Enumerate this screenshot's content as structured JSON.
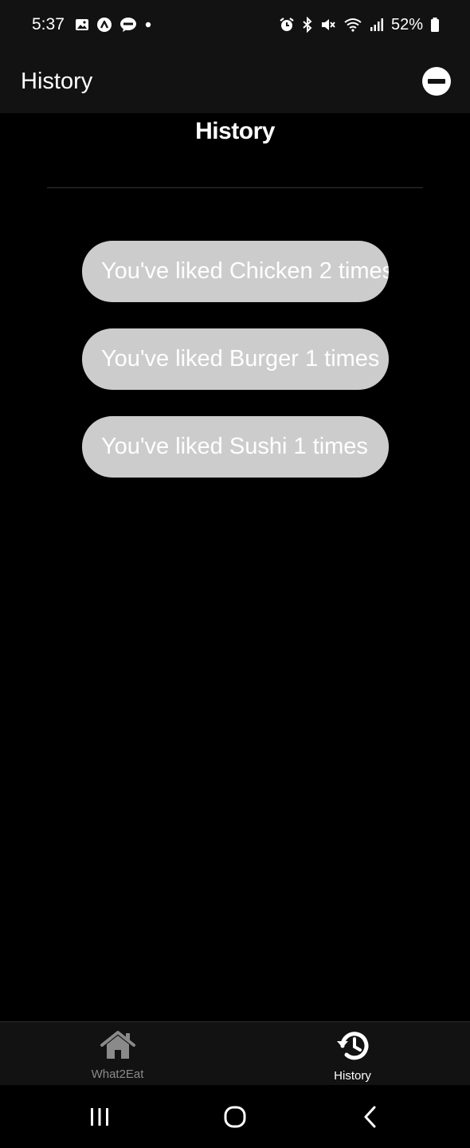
{
  "status_bar": {
    "time": "5:37",
    "battery": "52%",
    "left_icons": [
      "gallery-icon",
      "app-notification-icon",
      "talk-chat-icon",
      "dot-icon"
    ],
    "right_icons": [
      "alarm-icon",
      "bluetooth-icon",
      "mute-icon",
      "wifi-icon",
      "signal-icon",
      "battery-icon"
    ]
  },
  "app_bar": {
    "title": "History",
    "action_icon": "minus-circle-icon"
  },
  "page": {
    "heading": "History",
    "items": [
      {
        "label": "You've liked Chicken 2 times"
      },
      {
        "label": "You've liked Burger 1 times"
      },
      {
        "label": "You've liked Sushi 1 times"
      }
    ]
  },
  "bottom_nav": {
    "tabs": [
      {
        "label": "What2Eat",
        "icon": "home-icon",
        "active": false
      },
      {
        "label": "History",
        "icon": "history-icon",
        "active": true
      }
    ]
  },
  "system_nav": {
    "buttons": [
      "recent-apps-icon",
      "home-circle-icon",
      "back-icon"
    ]
  },
  "colors": {
    "background": "#000000",
    "bar": "#121212",
    "item_background": "#cccccc",
    "inactive_nav": "#8a8a8a"
  }
}
